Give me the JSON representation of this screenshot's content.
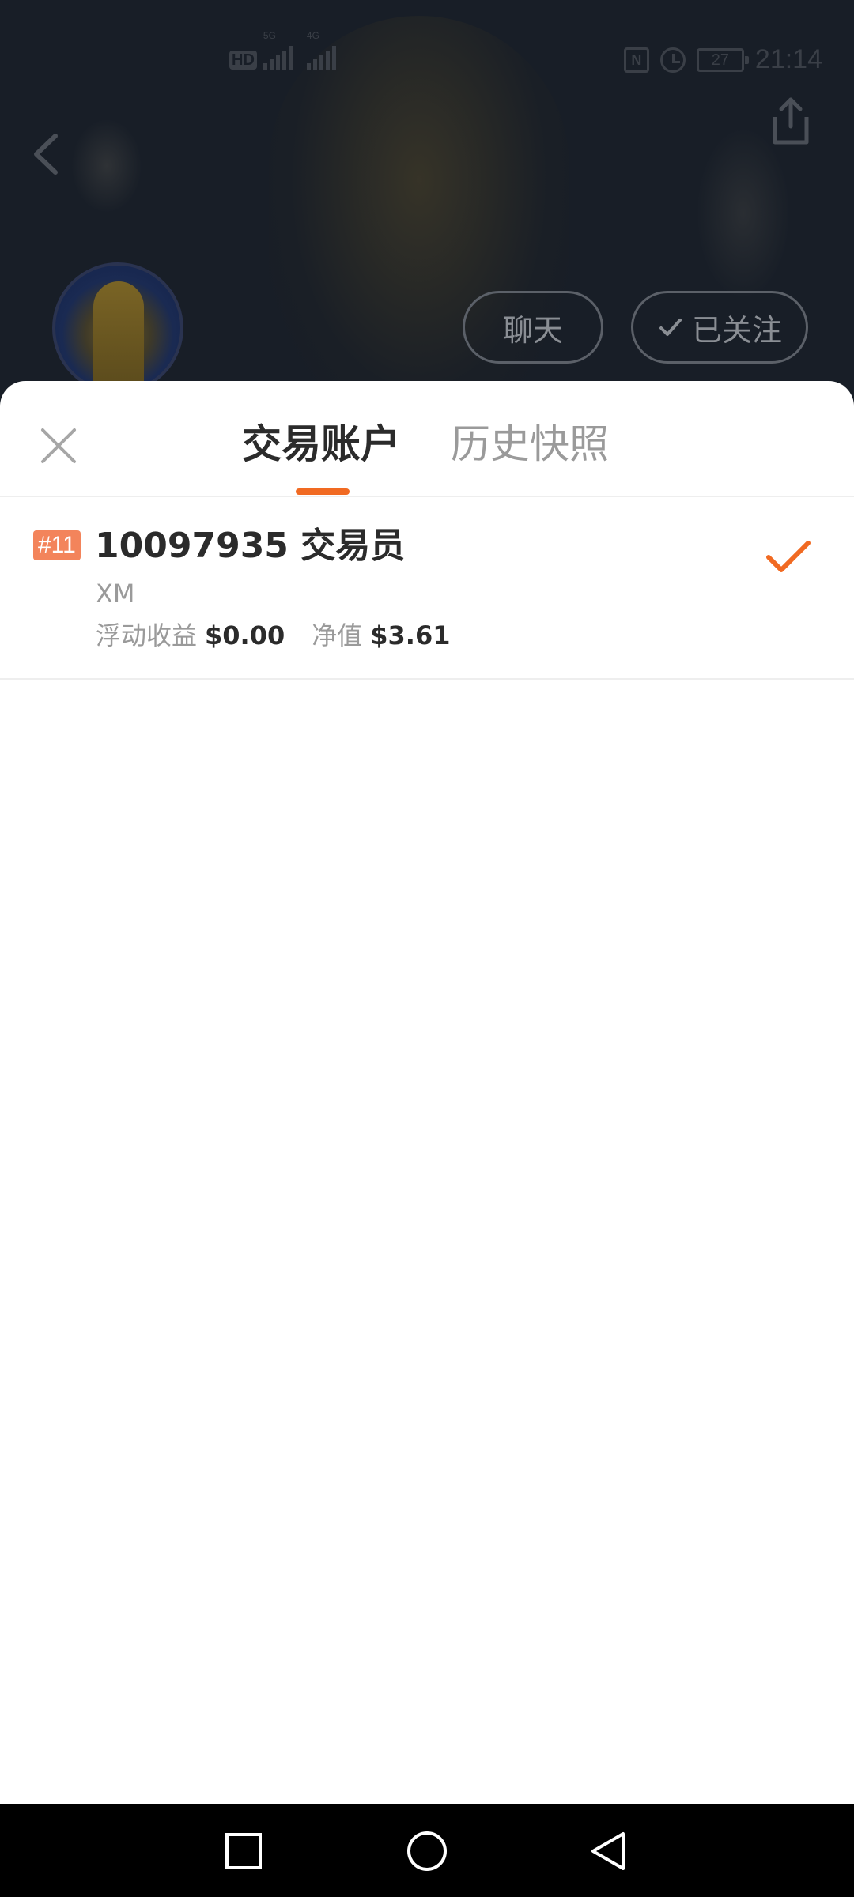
{
  "status_bar": {
    "network_badge": "HD",
    "signal_1_tag": "5G",
    "signal_2_tag": "4G",
    "nfc_label": "N",
    "battery_level": "27",
    "time": "21:14"
  },
  "profile": {
    "chat_label": "聊天",
    "follow_label": "已关注",
    "following": true
  },
  "sheet": {
    "tabs": [
      {
        "label": "交易账户",
        "active": true
      },
      {
        "label": "历史快照",
        "active": false
      }
    ],
    "accounts": [
      {
        "rank": "#11",
        "title": "10097935 交易员",
        "broker": "XM",
        "floating_pnl_label": "浮动收益",
        "floating_pnl_value": "$0.00",
        "equity_label": "净值",
        "equity_value": "$3.61",
        "selected": true
      }
    ]
  },
  "colors": {
    "accent": "#f16a22",
    "rank_badge": "#f3845b",
    "primary_text": "#2b2b2b",
    "secondary_text": "#9a9a9a",
    "overlay_bg": "#181e27"
  },
  "icons": {
    "back": "chevron-left-icon",
    "share": "share-icon",
    "close": "close-icon",
    "selected": "checkmark-icon",
    "nav_recents": "square-icon",
    "nav_home": "circle-icon",
    "nav_back": "triangle-back-icon"
  }
}
